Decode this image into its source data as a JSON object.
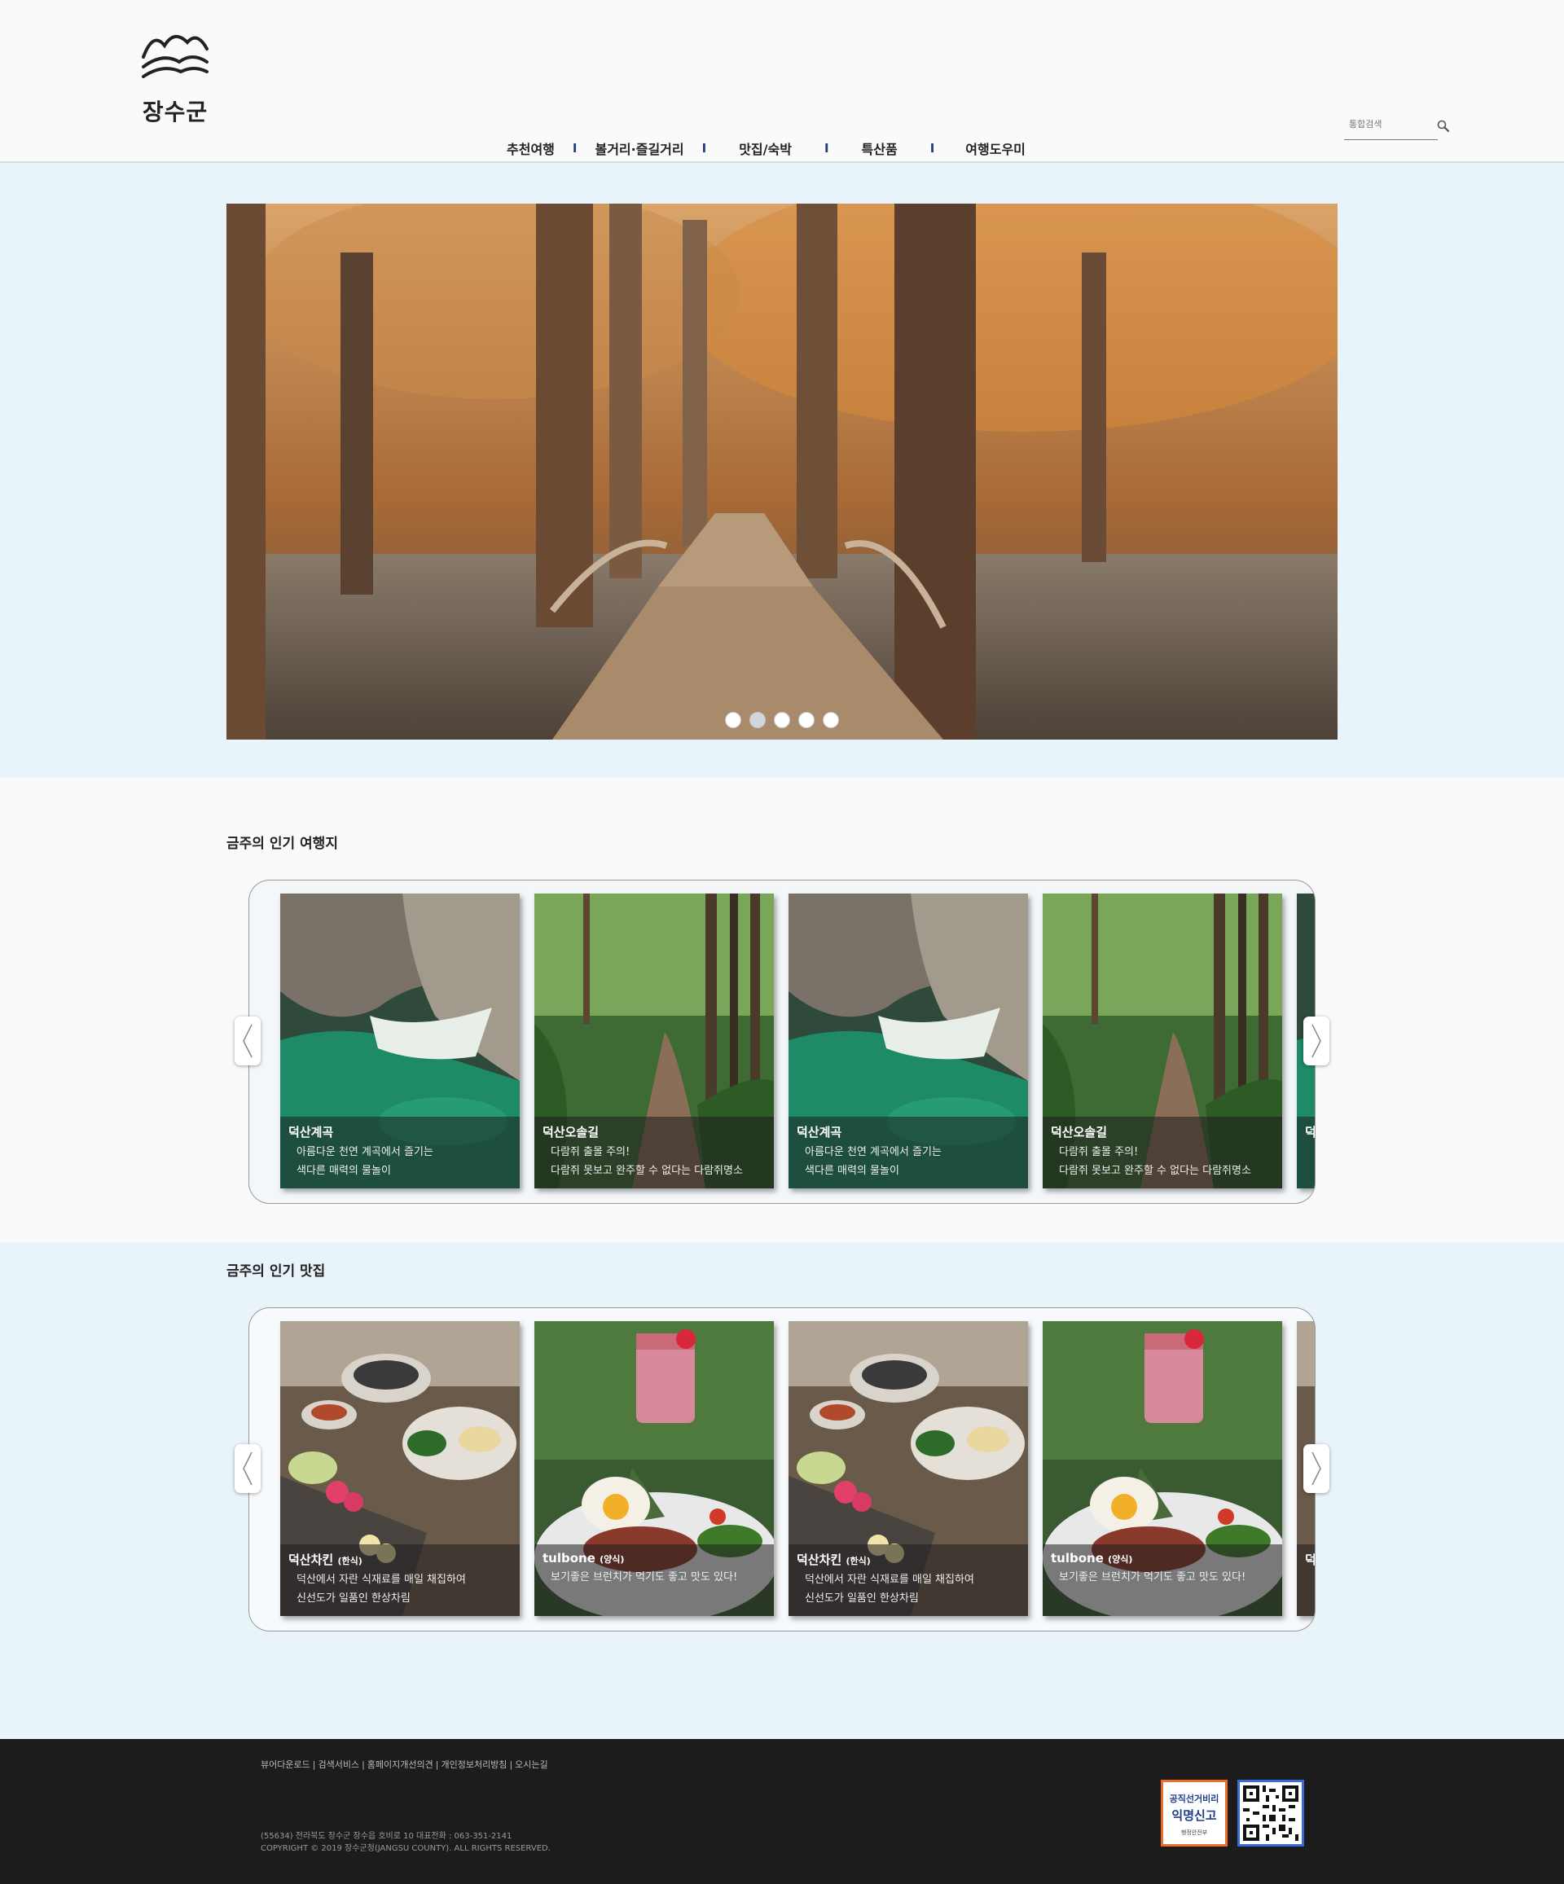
{
  "header": {
    "logo_text": "장수군",
    "nav": [
      "추천여행",
      "볼거리·즐길거리",
      "맛집/숙박",
      "특산품",
      "여행도우미"
    ],
    "nav_separator": "I",
    "search_placeholder": "통합검색"
  },
  "hero": {
    "slide_count": 5,
    "active_slide": 2
  },
  "travel": {
    "title": "금주의 인기 여행지",
    "cards": [
      {
        "title": "덕산계곡",
        "line1": "아름다운 천연 계곡에서 즐기는",
        "line2": "색다른 매력의 물놀이"
      },
      {
        "title": "덕산오솔길",
        "line1": "다람쥐 출몰 주의!",
        "line2": "다람쥐 못보고 완주할 수 없다는 다람쥐명소"
      },
      {
        "title": "덕산계곡",
        "line1": "아름다운 천연 계곡에서 즐기는",
        "line2": "색다른 매력의 물놀이"
      },
      {
        "title": "덕산오솔길",
        "line1": "다람쥐 출몰 주의!",
        "line2": "다람쥐 못보고 완주할 수 없다는 다람쥐명소"
      },
      {
        "title": "덕",
        "line1": "",
        "line2": ""
      }
    ]
  },
  "food": {
    "title": "금주의 인기 맛집",
    "cards": [
      {
        "title": "덕산차킨",
        "tag": "(한식)",
        "line1": "덕산에서 자란 식재료를 매일 채집하여",
        "line2": "신선도가 일품인 한상차림"
      },
      {
        "title": "tulbone",
        "tag": "(양식)",
        "line1": "보기좋은 브런치가 먹기도 좋고 맛도 있다!",
        "line2": ""
      },
      {
        "title": "덕산차킨",
        "tag": "(한식)",
        "line1": "덕산에서 자란 식재료를 매일 채집하여",
        "line2": "신선도가 일품인 한상차림"
      },
      {
        "title": "tulbone",
        "tag": "(양식)",
        "line1": "보기좋은 브런치가 먹기도 좋고 맛도 있다!",
        "line2": ""
      },
      {
        "title": "덕",
        "tag": "",
        "line1": "",
        "line2": ""
      }
    ]
  },
  "footer": {
    "links": [
      "뷰어다운로드",
      "검색서비스",
      "홈페이지개선의견",
      "개인정보처리방침",
      "오시는길"
    ],
    "address": "(55634) 전라북도 장수군 장수읍 호비로 10 대표전화 : 063-351-2141",
    "copyright": "COPYRIGHT © 2019 장수군청(JANGSU COUNTY). ALL RIGHTS RESERVED.",
    "badge_line1": "공직선거비리",
    "badge_line2": "익명신고",
    "badge_line3": "행정안전부"
  },
  "colors": {
    "accent_band": "#e9f3fa",
    "nav_separator": "#24407a",
    "footer_bg": "#1c1c1c",
    "badge_border": "#e8702a",
    "qr_border": "#3a6ad4"
  }
}
